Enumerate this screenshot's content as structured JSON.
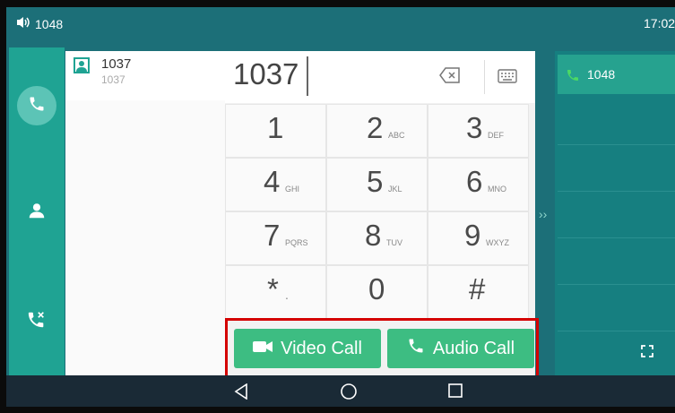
{
  "status_bar": {
    "line": "1048",
    "time": "17:02",
    "speaker_icon": "speaker-icon"
  },
  "sidebar": {
    "items": [
      {
        "name": "phone-icon",
        "active": true
      },
      {
        "name": "contacts-icon",
        "active": false
      },
      {
        "name": "call-history-icon",
        "active": false
      }
    ]
  },
  "contacts": {
    "items": [
      {
        "name": "1037",
        "number": "1037"
      }
    ]
  },
  "dialer": {
    "input_value": "1037",
    "keys": [
      {
        "digit": "1",
        "letters": ""
      },
      {
        "digit": "2",
        "letters": "ABC"
      },
      {
        "digit": "3",
        "letters": "DEF"
      },
      {
        "digit": "4",
        "letters": "GHI"
      },
      {
        "digit": "5",
        "letters": "JKL"
      },
      {
        "digit": "6",
        "letters": "MNO"
      },
      {
        "digit": "7",
        "letters": "PQRS"
      },
      {
        "digit": "8",
        "letters": "TUV"
      },
      {
        "digit": "9",
        "letters": "WXYZ"
      },
      {
        "digit": "*",
        "letters": "."
      },
      {
        "digit": "0",
        "letters": ""
      },
      {
        "digit": "#",
        "letters": ""
      }
    ],
    "video_call_label": "Video Call",
    "audio_call_label": "Audio Call"
  },
  "line_panel": {
    "line_label": "1048",
    "arrow": "››"
  },
  "colors": {
    "accent": "#1fa393",
    "call_button": "#3dbd82",
    "highlight": "#d40000",
    "background": "#1c6f78"
  }
}
